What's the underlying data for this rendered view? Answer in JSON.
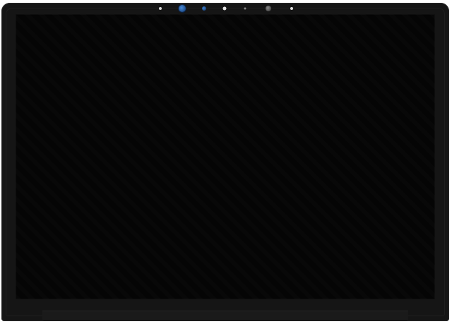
{
  "product": {
    "kind": "laptop LCD display panel",
    "screen_state": "off",
    "colors": {
      "bezel": "#151515",
      "screen": "#050505",
      "camera_lens": "#2f6fbf",
      "background": "#ffffff"
    }
  },
  "sensors": [
    {
      "name": "ambient-light-sensor"
    },
    {
      "name": "ir-camera"
    },
    {
      "name": "front-camera"
    },
    {
      "name": "camera-led"
    },
    {
      "name": "ir-led"
    },
    {
      "name": "lens"
    },
    {
      "name": "proximity-sensor"
    }
  ]
}
